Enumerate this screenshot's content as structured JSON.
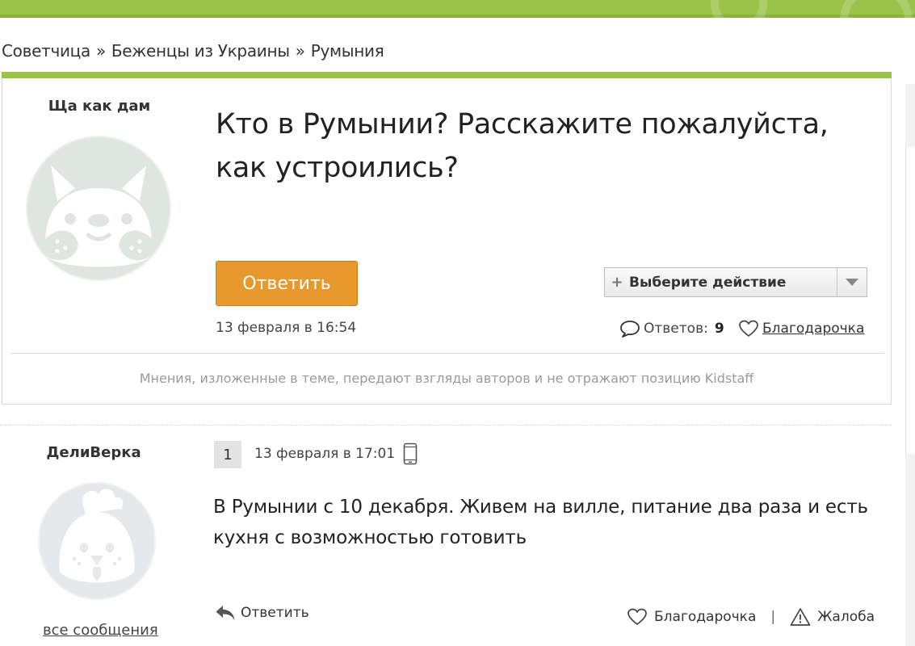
{
  "colors": {
    "brand_green": "#9bc34a",
    "reply_button": "#e8992d",
    "avatar_fill": "#dfe6e0"
  },
  "breadcrumb": {
    "items": [
      "Советчица",
      "Беженцы из Украины",
      "Румыния"
    ],
    "separator": "»"
  },
  "topic": {
    "author": "Ща как дам",
    "avatar_icon": "bear-avatar-icon",
    "title": "Кто в Румынии? Расскажите пожалуйста, как устроились?",
    "reply_button": "Ответить",
    "action_select": {
      "placeholder": "Выберите действие",
      "plus": "+"
    },
    "date": "13 февраля в 16:54",
    "replies_label": "Ответов:",
    "replies_count": "9",
    "thanks_label": "Благодарочка",
    "disclaimer": "Мнения, изложенные в теме, передают взгляды авторов и не отражают позицию Kidstaff"
  },
  "post": {
    "author": "ДелиВерка",
    "avatar_icon": "chicken-avatar-icon",
    "number": "1",
    "date": "13 февраля в 17:01",
    "device_icon": "mobile-phone-icon",
    "text": "В Румынии с 10 декабря. Живем на вилле, питание два раза и есть кухня с возможностью готовить",
    "reply_label": "Ответить",
    "thanks_label": "Благодарочка",
    "separator": "|",
    "complaint_label": "Жалоба",
    "all_messages_label": "все сообщения"
  }
}
